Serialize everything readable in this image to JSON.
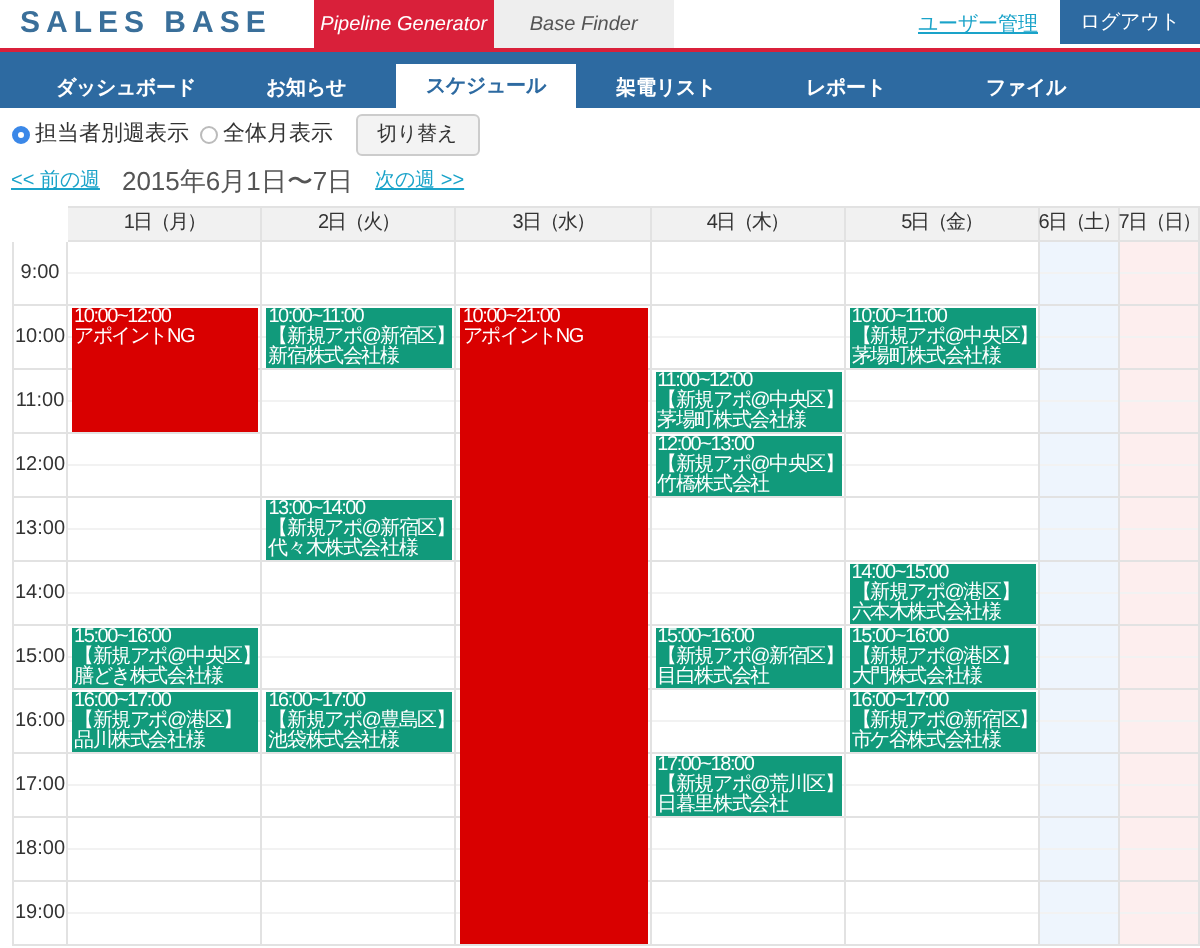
{
  "header": {
    "logo": "SALES BASE",
    "product_tabs": [
      {
        "label": "Pipeline Generator",
        "selected": true
      },
      {
        "label": "Base Finder",
        "selected": false
      }
    ],
    "user_link": "ユーザー管理",
    "logout_button": "ログアウト"
  },
  "nav_tabs": [
    {
      "label": "ダッシュボード",
      "selected": false
    },
    {
      "label": "お知らせ",
      "selected": false
    },
    {
      "label": "スケジュール",
      "selected": true
    },
    {
      "label": "架電リスト",
      "selected": false
    },
    {
      "label": "レポート",
      "selected": false
    },
    {
      "label": "ファイル",
      "selected": false
    }
  ],
  "view_options": [
    {
      "label": "担当者別週表示",
      "selected": true
    },
    {
      "label": "全体月表示",
      "selected": false
    }
  ],
  "switch_button": "切り替え",
  "week_nav": {
    "prev": "<< 前の週",
    "title": "2015年6月1日〜7日",
    "next": "次の週 >>"
  },
  "calendar": {
    "hours": [
      "9:00",
      "10:00",
      "11:00",
      "12:00",
      "13:00",
      "14:00",
      "15:00",
      "16:00",
      "17:00",
      "18:00",
      "19:00"
    ],
    "days": [
      {
        "label": "1日（月）",
        "kind": "weekday",
        "events": [
          {
            "kind": "ng",
            "time": "10:00~12:00",
            "title": "アポイントNG"
          },
          {
            "kind": "appointment",
            "time": "15:00~16:00",
            "area": "【新規アポ@中央区】",
            "company": "膳どき株式会社様"
          },
          {
            "kind": "appointment",
            "time": "16:00~17:00",
            "area": "【新規アポ@港区】",
            "company": "品川株式会社様"
          }
        ]
      },
      {
        "label": "2日（火）",
        "kind": "weekday",
        "events": [
          {
            "kind": "appointment",
            "time": "10:00~11:00",
            "area": "【新規アポ@新宿区】",
            "company": "新宿株式会社様"
          },
          {
            "kind": "appointment",
            "time": "13:00~14:00",
            "area": "【新規アポ@新宿区】",
            "company": "代々木株式会社様"
          },
          {
            "kind": "appointment",
            "time": "16:00~17:00",
            "area": "【新規アポ@豊島区】",
            "company": "池袋株式会社様"
          }
        ]
      },
      {
        "label": "3日（水）",
        "kind": "weekday",
        "events": [
          {
            "kind": "ng",
            "time": "10:00~21:00",
            "title": "アポイントNG"
          }
        ]
      },
      {
        "label": "4日（木）",
        "kind": "weekday",
        "events": [
          {
            "kind": "appointment",
            "time": "11:00~12:00",
            "area": "【新規アポ@中央区】",
            "company": "茅場町株式会社様"
          },
          {
            "kind": "appointment",
            "time": "12:00~13:00",
            "area": "【新規アポ@中央区】",
            "company": "竹橋株式会社"
          },
          {
            "kind": "appointment",
            "time": "15:00~16:00",
            "area": "【新規アポ@新宿区】",
            "company": "目白株式会社"
          },
          {
            "kind": "appointment",
            "time": "17:00~18:00",
            "area": "【新規アポ@荒川区】",
            "company": "日暮里株式会社"
          }
        ]
      },
      {
        "label": "5日（金）",
        "kind": "weekday",
        "events": [
          {
            "kind": "appointment",
            "time": "10:00~11:00",
            "area": "【新規アポ@中央区】",
            "company": "茅場町株式会社様"
          },
          {
            "kind": "appointment",
            "time": "14:00~15:00",
            "area": "【新規アポ@港区】",
            "company": "六本木株式会社様"
          },
          {
            "kind": "appointment",
            "time": "15:00~16:00",
            "area": "【新規アポ@港区】",
            "company": "大門株式会社様"
          },
          {
            "kind": "appointment",
            "time": "16:00~17:00",
            "area": "【新規アポ@新宿区】",
            "company": "市ケ谷株式会社様"
          }
        ]
      },
      {
        "label": "6日（土）",
        "kind": "saturday"
      },
      {
        "label": "7日（日）",
        "kind": "sunday"
      }
    ]
  }
}
